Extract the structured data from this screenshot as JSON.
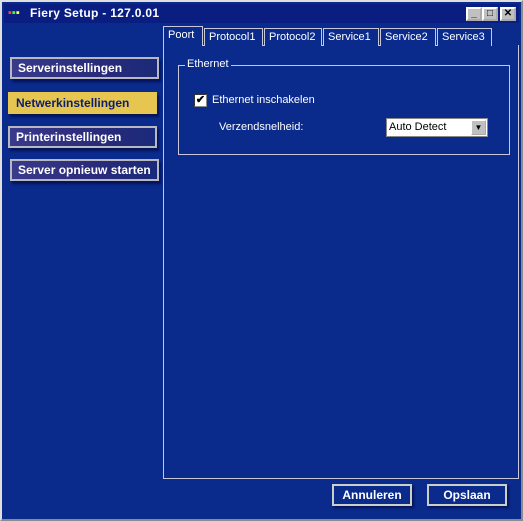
{
  "window": {
    "title": "Fiery Setup - 127.0.01",
    "minimize": "_",
    "maximize": "□",
    "close": "✕"
  },
  "sidebar": {
    "items": [
      {
        "label": "Serverinstellingen",
        "active": false
      },
      {
        "label": "Netwerkinstellingen",
        "active": true
      },
      {
        "label": "Printerinstellingen",
        "active": false
      },
      {
        "label": "Server opnieuw starten",
        "active": false
      }
    ]
  },
  "tabs": [
    {
      "label": "Poort",
      "active": true
    },
    {
      "label": "Protocol1"
    },
    {
      "label": "Protocol2"
    },
    {
      "label": "Service1"
    },
    {
      "label": "Service2"
    },
    {
      "label": "Service3"
    }
  ],
  "ethernet": {
    "legend": "Ethernet",
    "enable_label": "Ethernet inschakelen",
    "enable_checked": true,
    "check_mark": "✔",
    "speed_label": "Verzendsnelheid:",
    "speed_value": "Auto Detect",
    "dropdown_arrow": "▼"
  },
  "footer": {
    "cancel": "Annuleren",
    "save": "Opslaan"
  },
  "colors": {
    "background": "#0a2a8c",
    "active_item": "#e6c650",
    "title_bar": "#0a1e82"
  }
}
